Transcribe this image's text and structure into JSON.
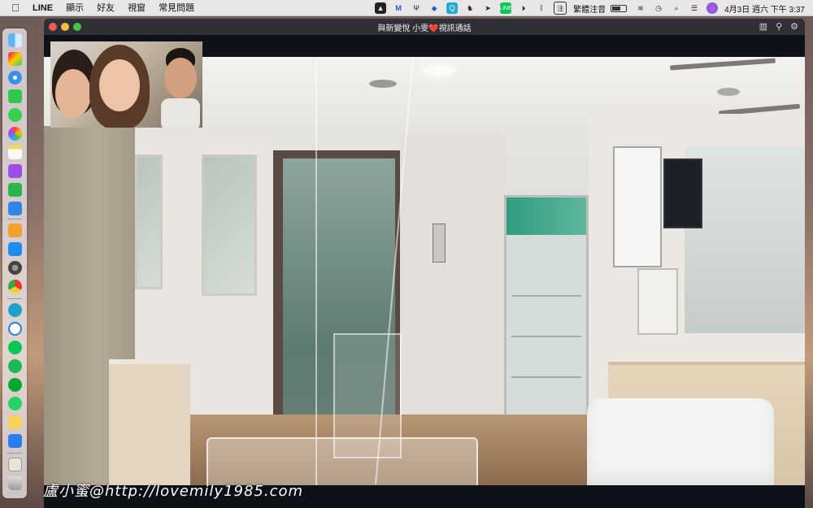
{
  "menubar": {
    "app_name": "LINE",
    "menus": [
      "顯示",
      "好友",
      "視窗",
      "常見問題"
    ],
    "input_method": "繁體注音",
    "datetime": "4月3日 週六 下午 3:37",
    "battery_level": 0.6
  },
  "window": {
    "title": "與新變悅 小雯❤️視訊通話"
  },
  "watermark": "盧小蜜@http://lovemily1985.com",
  "dock": {
    "apps": [
      "finder-icon",
      "launchpad-icon",
      "safari-icon",
      "facetime-icon",
      "messages-icon",
      "photos-icon",
      "notes-icon",
      "podcasts-icon",
      "numbers-icon",
      "keynote-icon",
      "pages-icon",
      "app-store-icon",
      "system-preferences-icon",
      "chrome-icon",
      "quicklook-icon",
      "dropbox-icon",
      "line-icon",
      "spotify-icon",
      "evernote-icon",
      "whatsapp-icon",
      "stickies-icon",
      "messenger-icon",
      "preview-icon",
      "trash-icon"
    ]
  },
  "colors": {
    "close": "#ee5b55",
    "minimize": "#f4bd3b",
    "maximize": "#48c248",
    "titlebar": "#2e3036"
  }
}
